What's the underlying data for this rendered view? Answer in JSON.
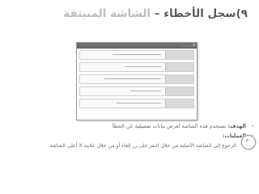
{
  "slide": {
    "title_number": "٩)",
    "title_main": "سجل الأخطاء –",
    "title_accent": " الشاشة المنبثقة",
    "page_number": "٣٠"
  },
  "bullets": {
    "goal_term": "الهدف:",
    "goal_text": " تستخدم هذه الشاشة لعرض بيانات تفصيلية عن الخطأ",
    "ops_term": "العمليات:",
    "ops_item": "الرجوع إلى الشاشة الأصلية من خلال النقر على زر إلغاء أو من خلال علامة X أعلى الشاشة"
  },
  "screenshot": {
    "close_glyph": "x"
  }
}
